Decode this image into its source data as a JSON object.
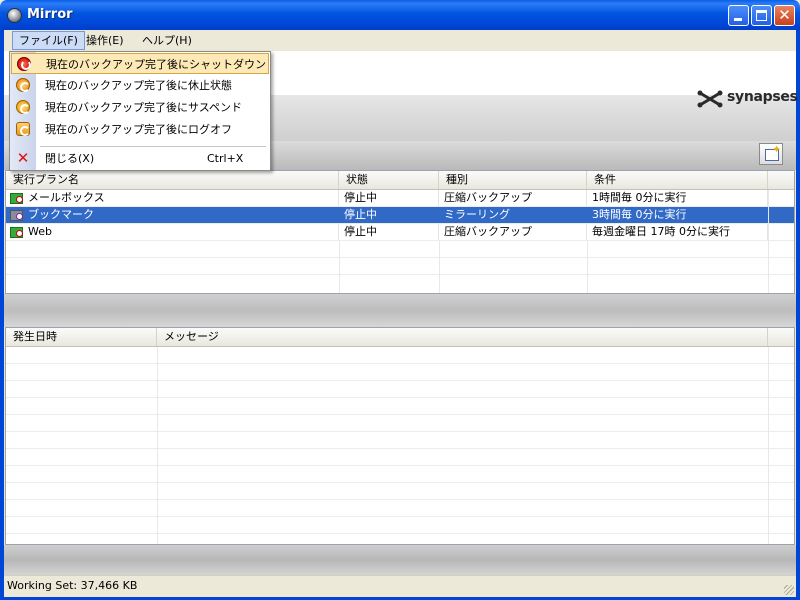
{
  "window": {
    "title": "Mirror"
  },
  "menubar": {
    "file": "ファイル(F)",
    "operation": "操作(E)",
    "help": "ヘルプ(H)"
  },
  "logo": {
    "text": "synapses"
  },
  "file_menu": {
    "items": [
      {
        "label": "現在のバックアップ完了後にシャットダウン",
        "icon": "power-icon",
        "highlighted": true
      },
      {
        "label": "現在のバックアップ完了後に休止状態",
        "icon": "hibernate-icon"
      },
      {
        "label": "現在のバックアップ完了後にサスペンド",
        "icon": "suspend-icon"
      },
      {
        "label": "現在のバックアップ完了後にログオフ",
        "icon": "logoff-icon"
      },
      {
        "label": "閉じる(X)",
        "shortcut": "Ctrl+X",
        "icon": "close-x-icon"
      }
    ]
  },
  "plans_table": {
    "columns": [
      "実行プラン名",
      "状態",
      "種別",
      "条件"
    ],
    "rows": [
      {
        "name": "メールボックス",
        "status": "停止中",
        "type": "圧縮バックアップ",
        "condition": "1時間毎 0分に実行",
        "selected": false
      },
      {
        "name": "ブックマーク",
        "status": "停止中",
        "type": "ミラーリング",
        "condition": "3時間毎 0分に実行",
        "selected": true
      },
      {
        "name": "Web",
        "status": "停止中",
        "type": "圧縮バックアップ",
        "condition": "毎週金曜日 17時 0分に実行",
        "selected": false
      }
    ]
  },
  "log_table": {
    "columns": [
      "発生日時",
      "メッセージ"
    ]
  },
  "statusbar": {
    "text": "Working Set: 37,466 KB"
  },
  "colors": {
    "titlebar": "#0055e0",
    "selection": "#3169c6",
    "menu_highlight": "#fde9b6"
  }
}
